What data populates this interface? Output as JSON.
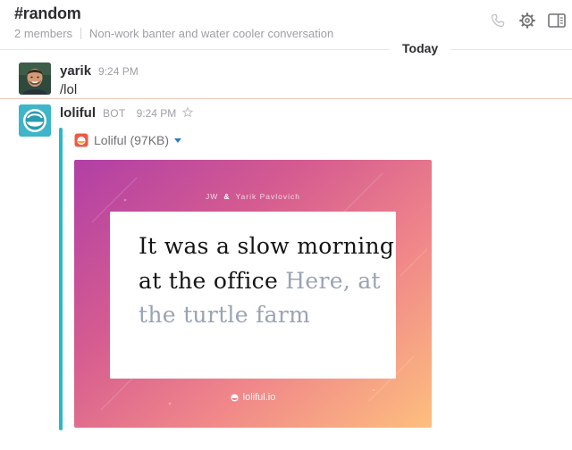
{
  "header": {
    "channel_name": "#random",
    "member_count": "2 members",
    "topic": "Non-work banter and water cooler conversation",
    "icons": [
      "phone-icon",
      "gear-icon",
      "sidebar-toggle-icon"
    ]
  },
  "divider": {
    "label": "Today"
  },
  "messages": [
    {
      "sender": "yarik",
      "time": "9:24 PM",
      "text": "/lol"
    },
    {
      "sender": "loliful",
      "bot_tag": "BOT",
      "time": "9:24 PM",
      "attachment": {
        "file_name": "Loliful (97KB)",
        "credits_left": "JW",
        "credits_amp": "&",
        "credits_right": "Yarik Pavlovich",
        "quote_main": "It was a slow morning at the office",
        "quote_punch": "Here, at the turtle farm",
        "footer": "loliful.io"
      }
    }
  ],
  "colors": {
    "accent_bar": "#2bb8c6",
    "new_message_line": "#f4c7b9",
    "caret": "#2a80b9"
  }
}
